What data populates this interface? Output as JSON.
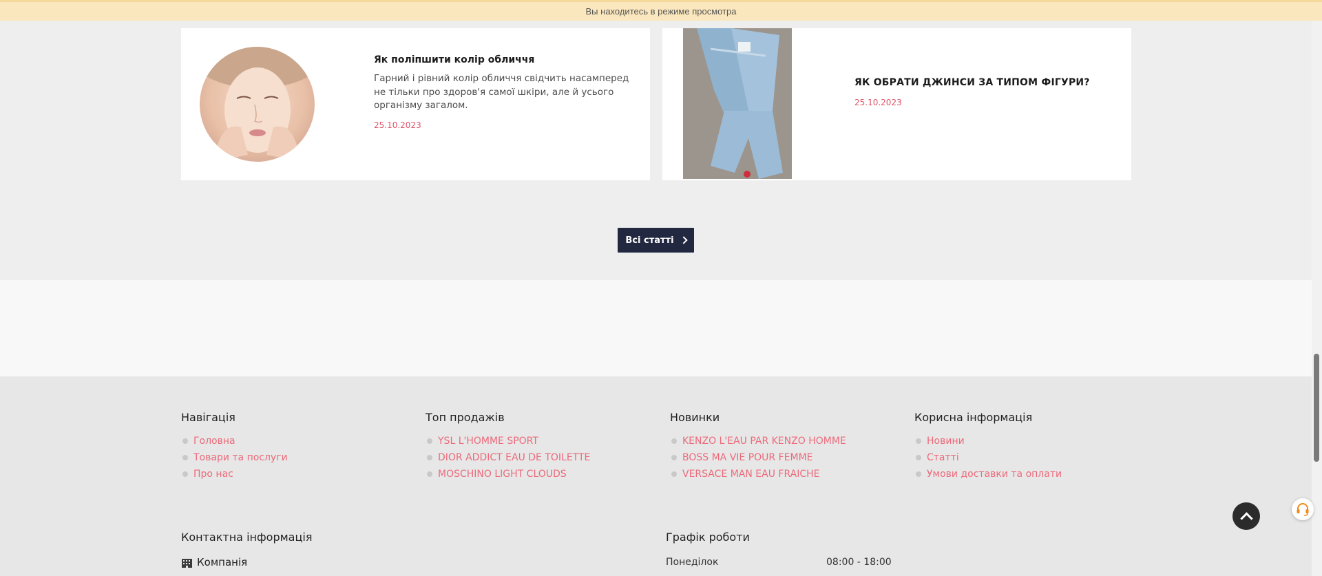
{
  "banner": {
    "text": "Вы находитесь в режиме просмотра"
  },
  "articles": [
    {
      "title": "Як поліпшити колір обличчя",
      "description": "Гарний і рівний колір обличчя свідчить насамперед не тільки про здоров'я самої шкіри, але й усього організму загалом.",
      "date": "25.10.2023",
      "image": "woman-face-photo"
    },
    {
      "title": "ЯК ОБРАТИ ДЖИНСИ ЗА ТИПОМ ФІГУРИ?",
      "date": "25.10.2023",
      "image": "jeans-photo"
    }
  ],
  "all_articles_button": {
    "label": "Всі статті",
    "icon": "chevron-right-icon"
  },
  "footer": {
    "columns": [
      {
        "title": "Навігація",
        "items": [
          "Головна",
          "Товари та послуги",
          "Про нас"
        ]
      },
      {
        "title": "Топ продажів",
        "items": [
          "YSL L'HOMME SPORT",
          "DIOR ADDICT EAU DE TOILETTE",
          "MOSCHINO LIGHT CLOUDS"
        ]
      },
      {
        "title": "Новинки",
        "items": [
          "KENZO L'EAU PAR KENZO HOMME",
          "BOSS MA VIE POUR FEMME",
          "VERSACE MAN EAU FRAICHE"
        ]
      },
      {
        "title": "Корисна інформація",
        "items": [
          "Новини",
          "Статті",
          "Умови доставки та оплати"
        ]
      }
    ],
    "contacts": {
      "title": "Контактна інформація",
      "company_label": "Компанія",
      "company_icon": "building-icon"
    },
    "schedule": {
      "title": "Графік роботи",
      "rows": [
        {
          "day": "Понеділок",
          "hours": "08:00 - 18:00"
        }
      ]
    }
  },
  "colors": {
    "link": "#ec6a7a",
    "accent_button": "#222840",
    "banner": "#fbe7bd",
    "date": "#e0546a"
  },
  "floating": {
    "scroll_top_icon": "chevron-up-icon",
    "support_icon": "headset-icon"
  }
}
